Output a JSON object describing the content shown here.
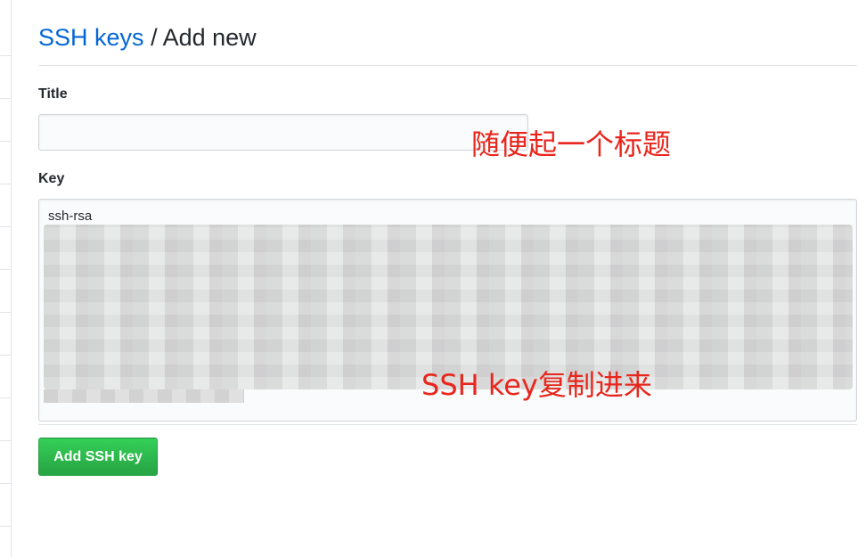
{
  "breadcrumb": {
    "link_label": "SSH keys",
    "separator": "/",
    "current_label": "Add new"
  },
  "form": {
    "title_label": "Title",
    "title_value": "",
    "key_label": "Key",
    "key_value_visible": "ssh-rsa",
    "submit_label": "Add SSH key"
  },
  "annotations": {
    "title_note": "随便起一个标题",
    "key_note": "SSH key复制进来"
  },
  "colors": {
    "link": "#0366d6",
    "primary_button": "#28a745",
    "annotation": "#e8261c"
  }
}
